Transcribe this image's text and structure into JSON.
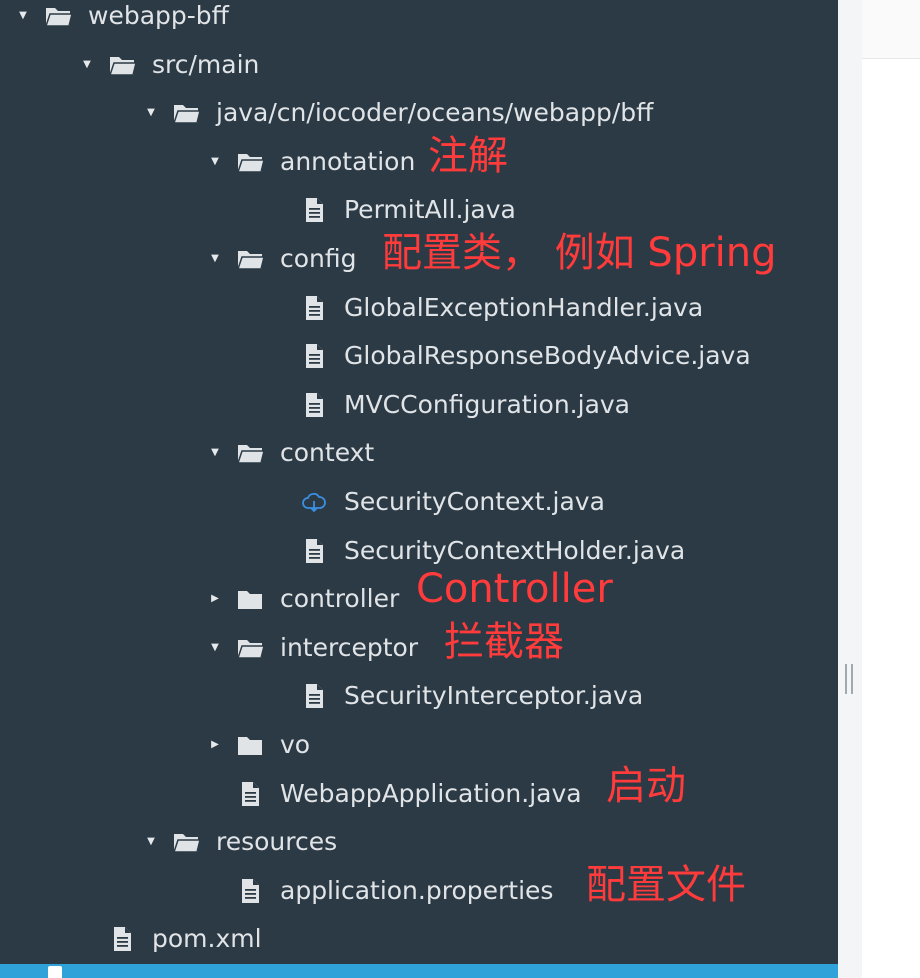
{
  "tree": {
    "nodes": [
      {
        "id": "webapp-bff",
        "label": "webapp-bff",
        "kind": "folder",
        "state": "expanded",
        "depth": 0,
        "interactable": true
      },
      {
        "id": "src-main",
        "label": "src/main",
        "kind": "folder",
        "state": "expanded",
        "depth": 1,
        "interactable": true
      },
      {
        "id": "java-package",
        "label": "java/cn/iocoder/oceans/webapp/bff",
        "kind": "folder",
        "state": "expanded",
        "depth": 2,
        "interactable": true
      },
      {
        "id": "annotation",
        "label": "annotation",
        "kind": "folder",
        "state": "expanded",
        "depth": 3,
        "interactable": true
      },
      {
        "id": "permitall",
        "label": "PermitAll.java",
        "kind": "file",
        "state": "none",
        "depth": 4,
        "interactable": true
      },
      {
        "id": "config",
        "label": "config",
        "kind": "folder",
        "state": "expanded",
        "depth": 3,
        "interactable": true
      },
      {
        "id": "global-exception-handler",
        "label": "GlobalExceptionHandler.java",
        "kind": "file",
        "state": "none",
        "depth": 4,
        "interactable": true
      },
      {
        "id": "global-response-body-advice",
        "label": "GlobalResponseBodyAdvice.java",
        "kind": "file",
        "state": "none",
        "depth": 4,
        "interactable": true
      },
      {
        "id": "mvc-configuration",
        "label": "MVCConfiguration.java",
        "kind": "file",
        "state": "none",
        "depth": 4,
        "interactable": true
      },
      {
        "id": "context",
        "label": "context",
        "kind": "folder",
        "state": "expanded",
        "depth": 3,
        "interactable": true
      },
      {
        "id": "security-context",
        "label": "SecurityContext.java",
        "kind": "cloud",
        "state": "none",
        "depth": 4,
        "interactable": true
      },
      {
        "id": "security-context-holder",
        "label": "SecurityContextHolder.java",
        "kind": "file",
        "state": "none",
        "depth": 4,
        "interactable": true
      },
      {
        "id": "controller",
        "label": "controller",
        "kind": "folder",
        "state": "collapsed",
        "depth": 3,
        "interactable": true
      },
      {
        "id": "interceptor",
        "label": "interceptor",
        "kind": "folder",
        "state": "expanded",
        "depth": 3,
        "interactable": true
      },
      {
        "id": "security-interceptor",
        "label": "SecurityInterceptor.java",
        "kind": "file",
        "state": "none",
        "depth": 4,
        "interactable": true
      },
      {
        "id": "vo",
        "label": "vo",
        "kind": "folder",
        "state": "collapsed",
        "depth": 3,
        "interactable": true
      },
      {
        "id": "webapp-application",
        "label": "WebappApplication.java",
        "kind": "file",
        "state": "none",
        "depth": 3,
        "interactable": true
      },
      {
        "id": "resources",
        "label": "resources",
        "kind": "folder",
        "state": "expanded",
        "depth": 2,
        "interactable": true
      },
      {
        "id": "application-properties",
        "label": "application.properties",
        "kind": "file",
        "state": "none",
        "depth": 3,
        "interactable": true
      },
      {
        "id": "pom-xml",
        "label": "pom.xml",
        "kind": "file",
        "state": "none",
        "depth": 1,
        "interactable": true
      }
    ]
  },
  "annotations": [
    {
      "id": "annotation",
      "text": "注解"
    },
    {
      "id": "config",
      "text": "配置类， 例如 Spring"
    },
    {
      "id": "controller",
      "text": "Controller"
    },
    {
      "id": "interceptor",
      "text": "拦截器"
    },
    {
      "id": "webapp-application",
      "text": "启动"
    },
    {
      "id": "application-properties",
      "text": "配置文件"
    }
  ],
  "colors": {
    "sidebar_bg": "#2b3a45",
    "text": "#e1e4e7",
    "annotation": "#ff3b3b",
    "cloud_icon": "#3b8fe0",
    "selection_bar": "#2fa3d9"
  }
}
